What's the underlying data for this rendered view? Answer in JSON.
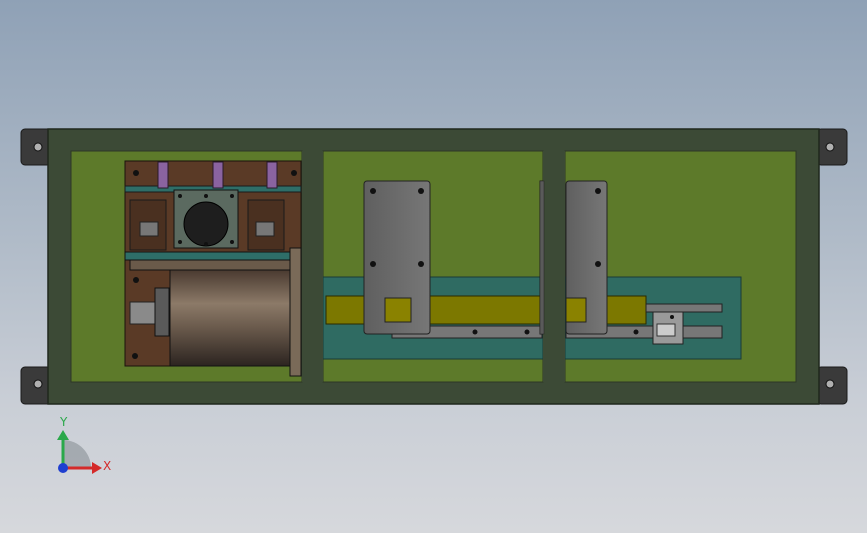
{
  "view": {
    "background_top": "#8fa1b6",
    "background_bottom": "#d6d8dc"
  },
  "model": {
    "frame_color": "#3c4a36",
    "panel_color": "#5d7a2a",
    "panel_border": "#2d3626",
    "channel_color": "#2f6b62",
    "rail_color": "#7c7800",
    "plate_color": "#6f6f6f",
    "brown_color": "#5a3a26",
    "motor_color": "#6a5a4a",
    "purple_color": "#8a63a0"
  },
  "triad": {
    "y_label": "Y",
    "x_label": "X",
    "y_color": "#2aa84a",
    "x_color": "#d42a2a",
    "z_color": "#1f3fd0"
  }
}
